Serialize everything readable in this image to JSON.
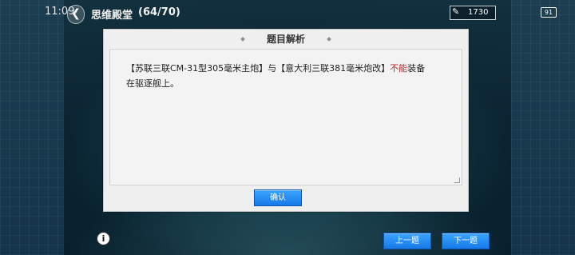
{
  "status_bar": {
    "time": "11:09",
    "battery": "91"
  },
  "header": {
    "title": "思维殿堂",
    "progress": "(64/70)"
  },
  "currency": {
    "value": "1730"
  },
  "dialog": {
    "title": "题目解析",
    "question_part1": "【苏联三联CM-31型305毫米主炮】与【意大利三联381毫米炮改】",
    "question_highlight": "不能",
    "question_part2": "装备",
    "question_line2": "在驱逐舰上。",
    "confirm_label": "确认"
  },
  "footer": {
    "prev_label": "上一题",
    "next_label": "下一题"
  },
  "colors": {
    "accent_button": "#1f8cf5",
    "highlight": "#c92424",
    "dialog_bg": "#efefef"
  }
}
